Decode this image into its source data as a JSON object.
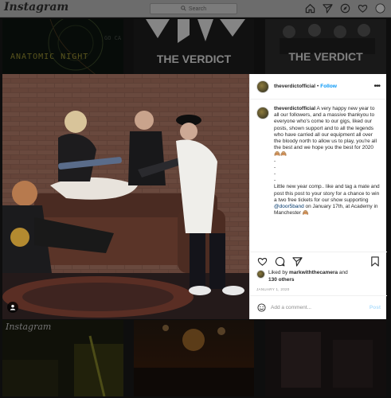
{
  "nav": {
    "logo": "Instagram",
    "search_placeholder": "Search",
    "icons": [
      "home-icon",
      "direct-icon",
      "explore-icon",
      "activity-icon",
      "profile-avatar"
    ]
  },
  "grid": {
    "tile1": {
      "title": "ANATOMIC  NIGHT",
      "subtitle": "GO CA"
    },
    "tile2": {
      "title": "THE VERDICT"
    },
    "tile3": {
      "title": "THE VERDICT"
    },
    "tile4": {
      "label": "Instagram"
    }
  },
  "post": {
    "username": "theverdictofficial",
    "follow_label": "Follow",
    "more_label": "•••",
    "caption_user": "theverdictofficial",
    "caption_body": " A very happy new year to all our followers, and a massive thankyou to everyone who's come to our gigs, liked our posts, shown support and to all the legends who have carried all our equipment all over the bloody north to allow us to play, you're all the best and we hope you the best for 2020 🙈🙈\n-\n-\n-\n-\nLittle new year comp.. like and tag a mate and post this post to your story for a chance to win a two free tickets for our show supporting ",
    "caption_mention": "@door5band",
    "caption_tail": " on January 17th, at Academy in Manchester 🙈",
    "liked_by_prefix": "Liked by ",
    "liked_by_user": "markwiththecamera",
    "liked_by_and": " and",
    "liked_by_others": "130 others",
    "date": "JANUARY 1, 2020",
    "comment_placeholder": "Add a comment...",
    "post_label": "Post"
  },
  "colors": {
    "accent": "#0095f6",
    "post_disabled": "#b2dffc",
    "mention": "#00376b"
  }
}
